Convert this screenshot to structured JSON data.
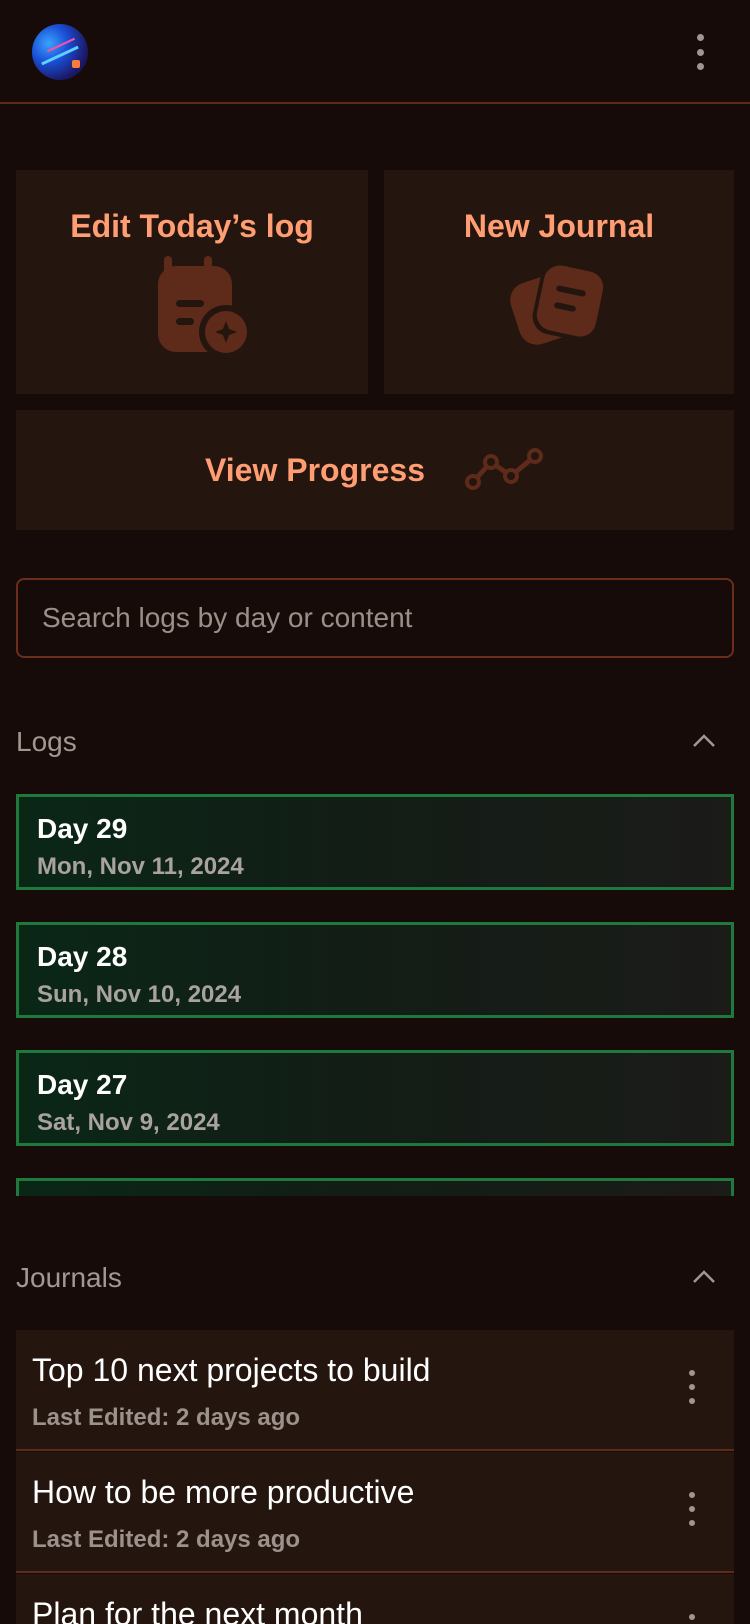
{
  "header": {
    "avatar_icon": "profile-avatar",
    "menu_icon": "kebab-menu-icon"
  },
  "actions": {
    "edit_today": {
      "label": "Edit Today’s log",
      "icon": "calendar-edit-icon"
    },
    "new_journal": {
      "label": "New Journal",
      "icon": "journal-notes-icon"
    },
    "view_progress": {
      "label": "View Progress",
      "icon": "trend-line-icon"
    }
  },
  "search": {
    "placeholder": "Search logs by day or content",
    "value": ""
  },
  "logs": {
    "title": "Logs",
    "items": [
      {
        "day": "Day 29",
        "date": "Mon, Nov 11, 2024"
      },
      {
        "day": "Day 28",
        "date": "Sun, Nov 10, 2024"
      },
      {
        "day": "Day 27",
        "date": "Sat, Nov 9, 2024"
      },
      {
        "day": "",
        "date": ""
      }
    ]
  },
  "journals": {
    "title": "Journals",
    "items": [
      {
        "title": "Top 10 next projects to build",
        "edited": "Last Edited: 2 days ago"
      },
      {
        "title": "How to be more productive",
        "edited": "Last Edited: 2 days ago"
      },
      {
        "title": "Plan for the next month",
        "edited": ""
      }
    ]
  },
  "colors": {
    "background": "#170b09",
    "card": "#24150f",
    "accent": "#ff9d73",
    "icon_fill": "#5e2a19",
    "log_border": "#1e7a3c",
    "divider": "#5e2b18"
  }
}
